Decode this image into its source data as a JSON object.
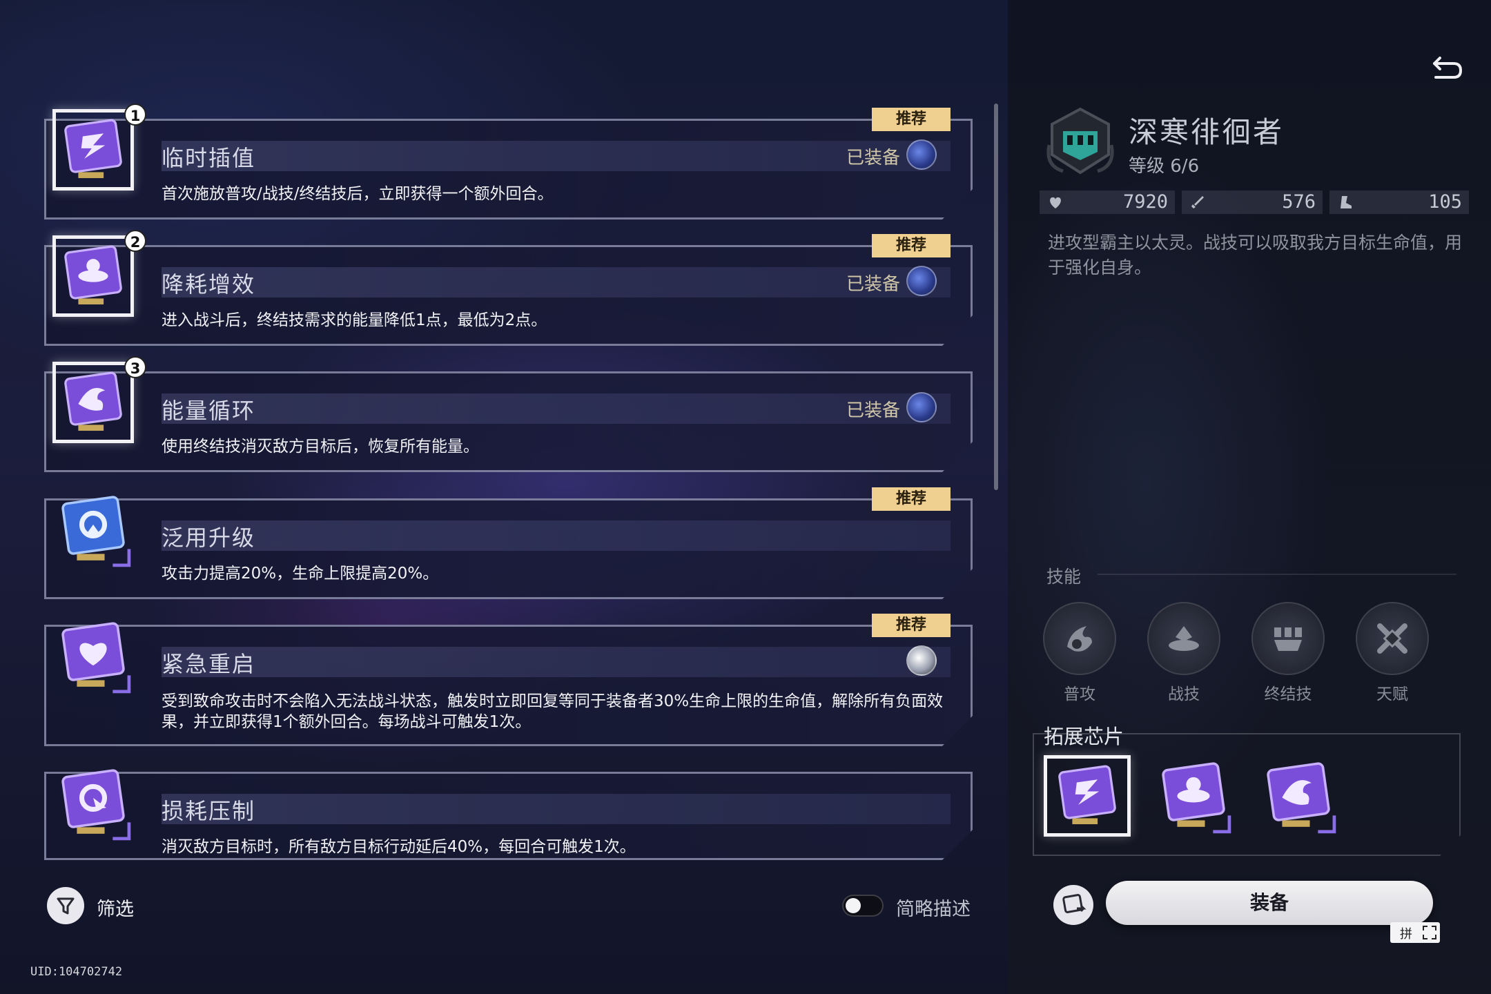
{
  "chips": [
    {
      "title": "临时插值",
      "desc": "首次施放普攻/战技/终结技后，立即获得一个额外回合。",
      "recommended": "推荐",
      "equipped": "已装备",
      "slot": "1"
    },
    {
      "title": "降耗增效",
      "desc": "进入战斗后，终结技需求的能量降低1点，最低为2点。",
      "recommended": "推荐",
      "equipped": "已装备",
      "slot": "2"
    },
    {
      "title": "能量循环",
      "desc": "使用终结技消灭敌方目标后，恢复所有能量。",
      "equipped": "已装备",
      "slot": "3"
    },
    {
      "title": "泛用升级",
      "desc": "攻击力提高20%，生命上限提高20%。",
      "recommended": "推荐"
    },
    {
      "title": "紧急重启",
      "desc": "受到致命攻击时不会陷入无法战斗状态，触发时立即回复等同于装备者30%生命上限的生命值，解除所有负面效果，并立即获得1个额外回合。每场战斗可触发1次。",
      "recommended": "推荐"
    },
    {
      "title": "损耗压制",
      "desc": "消灭敌方目标时，所有敌方目标行动延后40%，每回合可触发1次。"
    }
  ],
  "bottom": {
    "filter_label": "筛选",
    "brief_label": "简略描述",
    "uid": "UID:104702742"
  },
  "enemy": {
    "name": "深寒徘徊者",
    "level": "等级 6/6",
    "hp": "7920",
    "atk": "576",
    "spd": "105",
    "desc": "进攻型霸主以太灵。战技可以吸取我方目标生命值，用于强化自身。"
  },
  "skills": {
    "section_label": "技能",
    "items": [
      {
        "label": "普攻",
        "icon": "basic-attack-icon"
      },
      {
        "label": "战技",
        "icon": "skill-icon"
      },
      {
        "label": "终结技",
        "icon": "ultimate-icon"
      },
      {
        "label": "天赋",
        "icon": "talent-icon"
      }
    ]
  },
  "expansion": {
    "title": "拓展芯片"
  },
  "actions": {
    "equip_label": "装备"
  },
  "kbd": {
    "glyph": "拼"
  },
  "colors": {
    "recommend_badge": "#f0d090",
    "chip_purple": "#7a4ed8",
    "chip_blue": "#3a6ad8"
  }
}
